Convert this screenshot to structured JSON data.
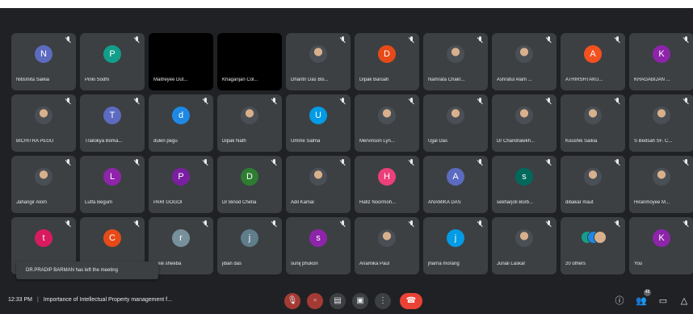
{
  "participants": [
    {
      "name": "Nitismita Saikia",
      "initial": "N",
      "color": "#5c6bc0",
      "type": "letter"
    },
    {
      "name": "Pinki Sodhi",
      "initial": "P",
      "color": "#129e8a",
      "type": "letter"
    },
    {
      "name": "Maitreyee Dut...",
      "type": "video"
    },
    {
      "name": "Khagarijan Col...",
      "type": "video"
    },
    {
      "name": "Dharitri Das Bis...",
      "type": "photo"
    },
    {
      "name": "Dipak Baruah",
      "initial": "D",
      "color": "#e64a19",
      "type": "letter"
    },
    {
      "name": "Namrata Chakr...",
      "type": "photo"
    },
    {
      "name": "Ashraful Alam ...",
      "type": "photo"
    },
    {
      "name": "ATHIRSHTAKU...",
      "initial": "A",
      "color": "#f4511e",
      "type": "letter"
    },
    {
      "name": "KHAGABIJAN ...",
      "initial": "K",
      "color": "#8e24aa",
      "type": "letter"
    },
    {
      "name": "BICHITRA PEGU",
      "type": "photo"
    },
    {
      "name": "Trailokya Borka...",
      "initial": "T",
      "color": "#5c6bc0",
      "type": "letter"
    },
    {
      "name": "dulen pegu",
      "initial": "d",
      "color": "#1e88e5",
      "type": "letter"
    },
    {
      "name": "Dipak Nath",
      "type": "photo"
    },
    {
      "name": "Umme Salma",
      "initial": "U",
      "color": "#039be5",
      "type": "letter"
    },
    {
      "name": "Mervinson Lyn...",
      "type": "photo"
    },
    {
      "name": "Ujjal Das",
      "type": "photo"
    },
    {
      "name": "Dr Chandralekh...",
      "type": "photo"
    },
    {
      "name": "Koushik Saikia",
      "type": "photo"
    },
    {
      "name": "S Bedsah SF. C...",
      "type": "photo"
    },
    {
      "name": "Jahangir Alom",
      "type": "photo"
    },
    {
      "name": "Lutfa Begum",
      "initial": "L",
      "color": "#8e24aa",
      "type": "letter"
    },
    {
      "name": "PARI GOGOI",
      "initial": "P",
      "color": "#7b1fa2",
      "type": "letter"
    },
    {
      "name": "Dr Binod Chetia",
      "initial": "D",
      "color": "#2e7d32",
      "type": "letter"
    },
    {
      "name": "Adil Kamal",
      "type": "photo"
    },
    {
      "name": "Hafiz Noormoh...",
      "initial": "H",
      "color": "#ec407a",
      "type": "letter"
    },
    {
      "name": "ANAMIKA DAS",
      "initial": "A",
      "color": "#5c6bc0",
      "type": "letter"
    },
    {
      "name": "sekharjoti Borb...",
      "initial": "s",
      "color": "#00695c",
      "type": "letter"
    },
    {
      "name": "dibakar maut",
      "type": "photo"
    },
    {
      "name": "Hiranmoyee M...",
      "type": "photo"
    },
    {
      "name": "",
      "initial": "t",
      "color": "#d81b60",
      "type": "letter"
    },
    {
      "name": "",
      "initial": "C",
      "color": "#e64a19",
      "type": "letter"
    },
    {
      "name": "roxie sheeba",
      "initial": "r",
      "color": "#78909c",
      "type": "letter"
    },
    {
      "name": "jiban das",
      "initial": "j",
      "color": "#607d8b",
      "type": "letter"
    },
    {
      "name": "sunij phukon",
      "initial": "s",
      "color": "#8e24aa",
      "type": "letter"
    },
    {
      "name": "Anamika Paul",
      "type": "photo"
    },
    {
      "name": "jharna morang",
      "initial": "j",
      "color": "#039be5",
      "type": "letter"
    },
    {
      "name": "Junali Laskar",
      "type": "photo"
    },
    {
      "name": "20 others",
      "type": "group"
    },
    {
      "name": "You",
      "initial": "K",
      "color": "#8e24aa",
      "type": "letter"
    }
  ],
  "group_colors": [
    "#129e8a",
    "#1e88e5",
    "#d9b08c"
  ],
  "toast": {
    "text": "DR.PRADIP BARMAN has left the meeting"
  },
  "bottom_bar": {
    "time": "12:33 PM",
    "separator": "|",
    "meeting_title": "Importance of Intellectual Property management f...",
    "badge_count": "48"
  },
  "controls": {
    "mic_icon": "mic-off-icon",
    "camera_icon": "camera-off-icon",
    "captions_icon": "captions-icon",
    "present_icon": "present-icon",
    "more_icon": "more-options-icon",
    "end_icon": "end-call-icon",
    "info_icon": "info-icon",
    "people_icon": "people-icon",
    "chat_icon": "chat-icon",
    "activities_icon": "activities-icon"
  }
}
